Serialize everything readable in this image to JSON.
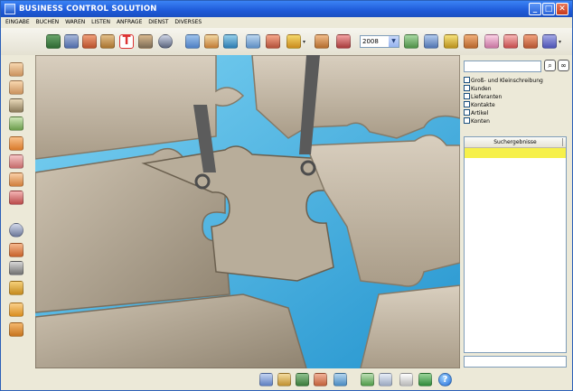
{
  "window": {
    "title": "BUSINESS CONTROL SOLUTION"
  },
  "menu": [
    "EINGABE",
    "BUCHEN",
    "WAREN",
    "LISTEN",
    "ANFRAGE",
    "DIENST",
    "DIVERSES"
  ],
  "toolbar": {
    "year": "2008"
  },
  "search": {
    "input_value": "",
    "options": [
      "Groß- und Kleinschreibung",
      "Kunden",
      "Lieferanten",
      "Kontakte",
      "Artikel",
      "Konten"
    ],
    "results_header": "Suchergebnisse"
  },
  "colors": {
    "titlebar": "#1e5ad8",
    "selection": "#f6f04a",
    "water": "#4ab6e6",
    "puzzle": "#c9bfae"
  }
}
